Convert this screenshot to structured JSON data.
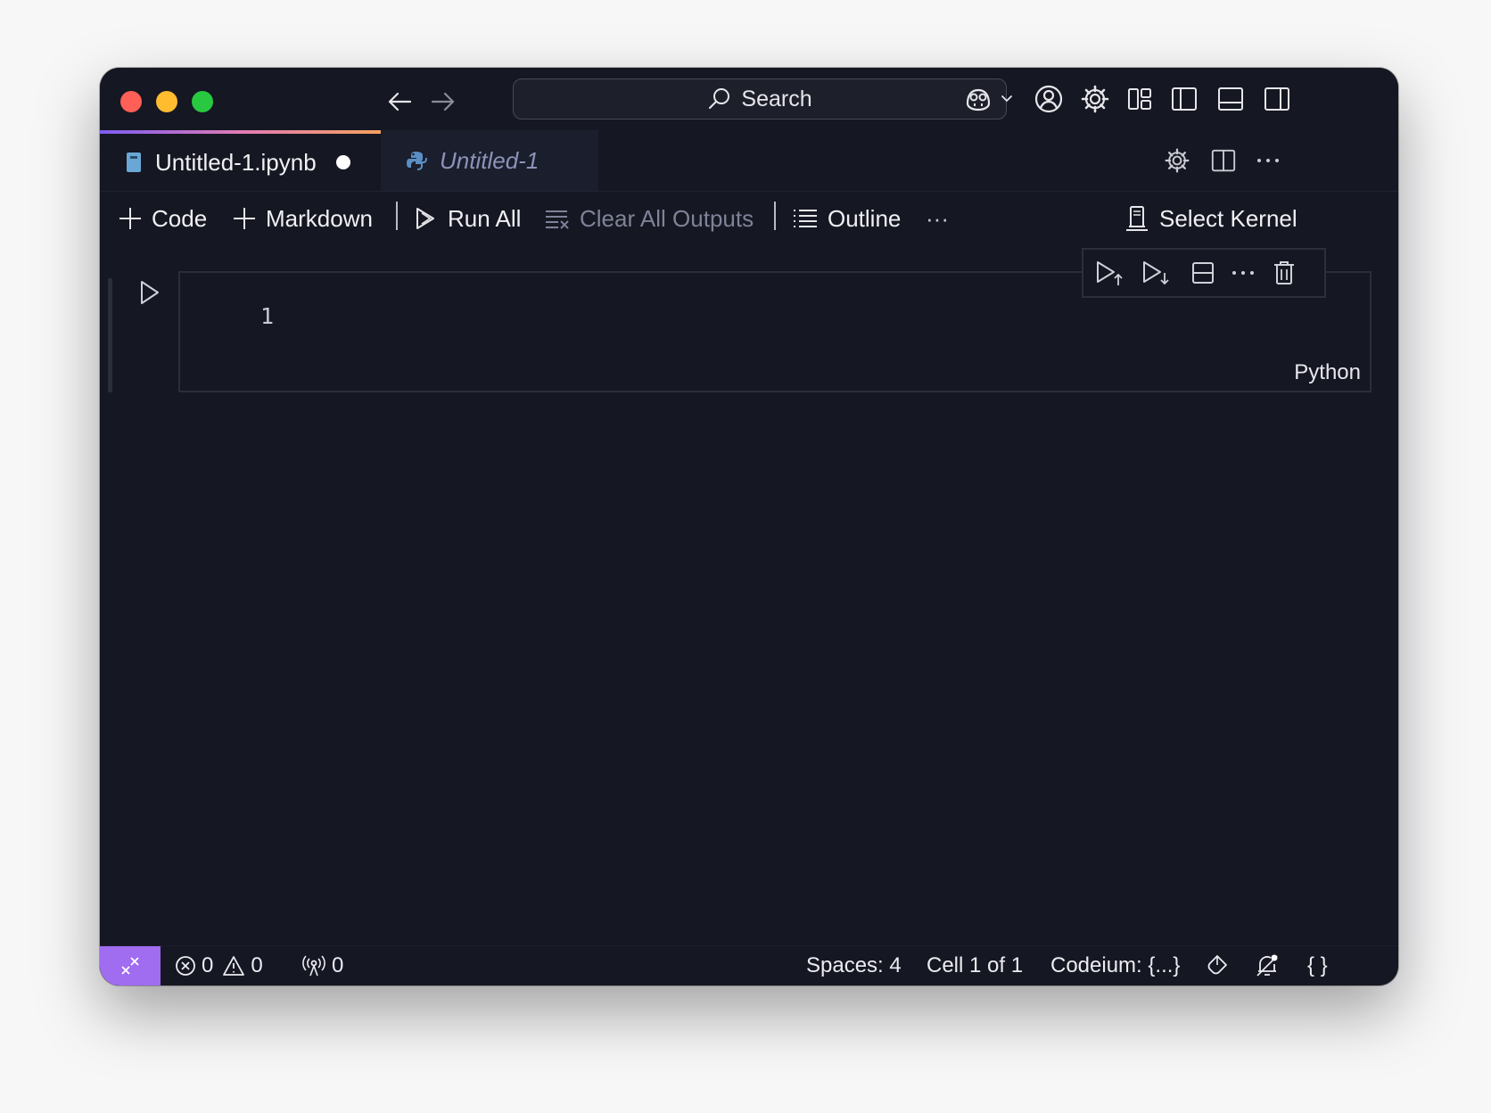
{
  "titlebar": {
    "search_label": "Search"
  },
  "tabs": [
    {
      "label": "Untitled-1.ipynb",
      "active": true,
      "dirty": true,
      "icon": "notebook-icon"
    },
    {
      "label": "Untitled-1",
      "active": false,
      "icon": "python-icon"
    }
  ],
  "toolbar": {
    "code_label": "Code",
    "markdown_label": "Markdown",
    "run_all_label": "Run All",
    "clear_outputs_label": "Clear All Outputs",
    "outline_label": "Outline",
    "more_label": "···",
    "select_kernel_label": "Select Kernel"
  },
  "cell": {
    "line_number": "1",
    "language": "Python"
  },
  "statusbar": {
    "errors": "0",
    "warnings": "0",
    "ports": "0",
    "spaces": "Spaces: 4",
    "cell_position": "Cell 1 of 1",
    "codeium": "Codeium: {...}",
    "braces": "{ }"
  },
  "colors": {
    "background": "#151722",
    "remote_indicator": "#a06cf0",
    "tab_gradient_start": "#7b5cf2",
    "tab_gradient_end": "#f5a05c"
  }
}
